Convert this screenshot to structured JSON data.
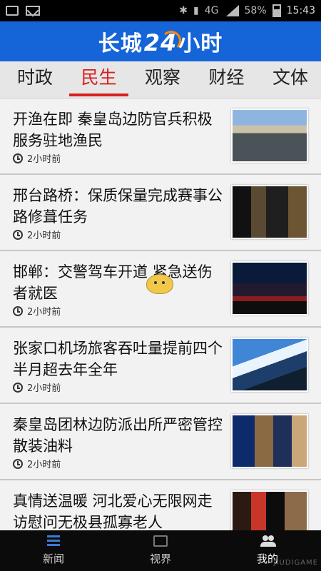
{
  "status_bar": {
    "icons_left": [
      "image-icon",
      "mail-icon"
    ],
    "icons_right": [
      "bluetooth-icon",
      "sim-icon",
      "4g-signal-icon",
      "battery-icon"
    ],
    "network": "4G",
    "battery": "58%",
    "time": "15:43"
  },
  "header": {
    "brand_prefix": "长城",
    "brand_number": "24",
    "brand_suffix": "小时",
    "colors": {
      "brand_bg": "#1565d8",
      "accent": "#ff8a00"
    }
  },
  "tabs": [
    {
      "label": "时政",
      "active": false
    },
    {
      "label": "民生",
      "active": true
    },
    {
      "label": "观察",
      "active": false
    },
    {
      "label": "财经",
      "active": false
    },
    {
      "label": "文体",
      "active": false
    }
  ],
  "news": [
    {
      "title": "开渔在即 秦皇岛边防官兵积极服务驻地渔民",
      "time": "2小时前"
    },
    {
      "title": "邢台路桥：保质保量完成赛事公路修葺任务",
      "time": "2小时前"
    },
    {
      "title": "邯郸：交警驾车开道 紧急送伤者就医",
      "time": "2小时前"
    },
    {
      "title": "张家口机场旅客吞吐量提前四个半月超去年全年",
      "time": "2小时前"
    },
    {
      "title": "秦皇岛团林边防派出所严密管控散装油料",
      "time": "2小时前"
    },
    {
      "title": "真情送温暖 河北爱心无限网走访慰问无极县孤寡老人",
      "time": ""
    }
  ],
  "bottom_nav": [
    {
      "label": "新闻",
      "icon": "news-icon",
      "active": false
    },
    {
      "label": "视界",
      "icon": "video-icon",
      "active": false
    },
    {
      "label": "我的",
      "icon": "me-icon",
      "active": true
    }
  ],
  "watermark": "JIUDIGAME"
}
